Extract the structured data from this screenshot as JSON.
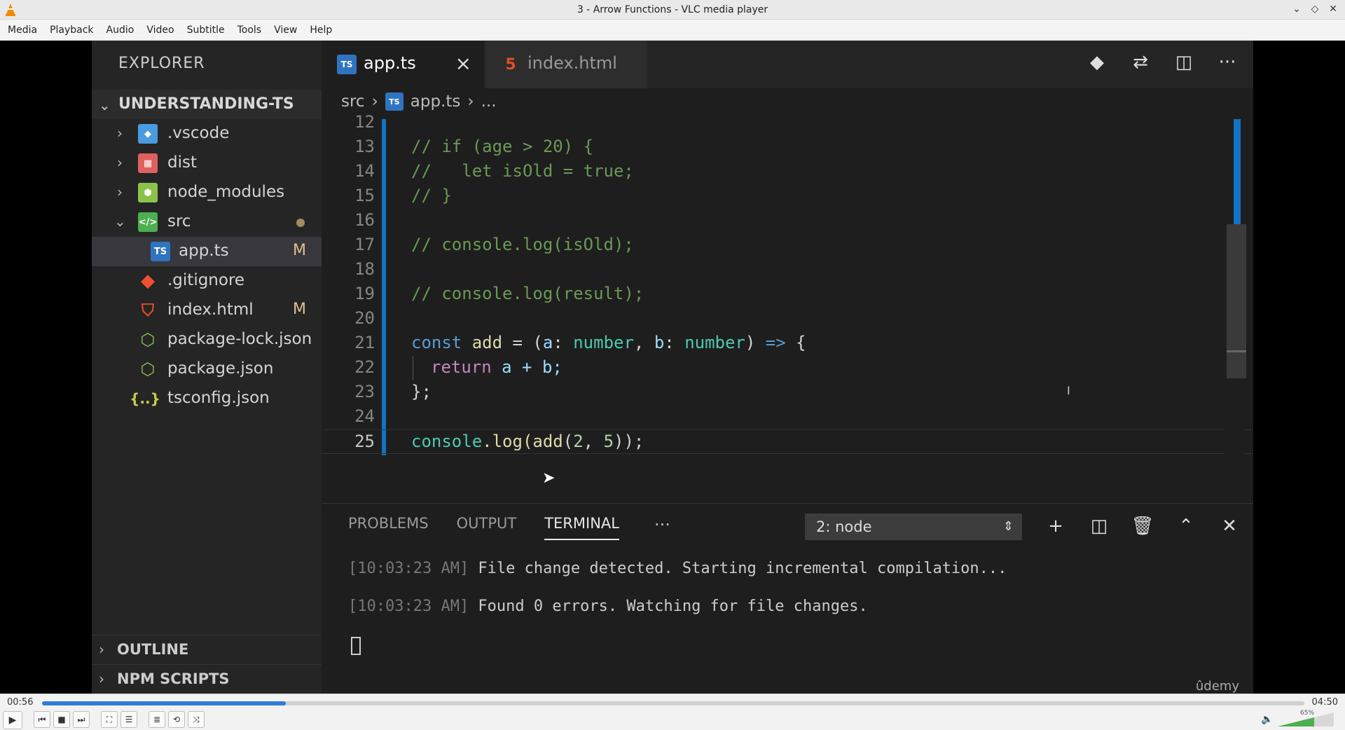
{
  "window": {
    "title": "3 - Arrow Functions - VLC media player"
  },
  "menu": [
    "Media",
    "Playback",
    "Audio",
    "Video",
    "Subtitle",
    "Tools",
    "View",
    "Help"
  ],
  "explorer": {
    "title": "EXPLORER",
    "project": "UNDERSTANDING-TS",
    "items": [
      {
        "label": ".vscode",
        "badge": "",
        "icon": "folder-vscode-icon"
      },
      {
        "label": "dist",
        "badge": "",
        "icon": "folder-dist-icon"
      },
      {
        "label": "node_modules",
        "badge": "",
        "icon": "folder-node-icon"
      },
      {
        "label": "src",
        "badge": "",
        "icon": "folder-src-icon"
      },
      {
        "label": "app.ts",
        "badge": "M",
        "icon": "typescript-file-icon"
      },
      {
        "label": ".gitignore",
        "badge": "",
        "icon": "git-icon"
      },
      {
        "label": "index.html",
        "badge": "M",
        "icon": "html5-icon"
      },
      {
        "label": "package-lock.json",
        "badge": "",
        "icon": "nodejs-icon"
      },
      {
        "label": "package.json",
        "badge": "",
        "icon": "nodejs-icon"
      },
      {
        "label": "tsconfig.json",
        "badge": "",
        "icon": "json-braces-icon"
      }
    ],
    "sections": [
      "OUTLINE",
      "NPM SCRIPTS"
    ]
  },
  "editor": {
    "tabs": [
      {
        "label": "app.ts",
        "icon_text": "TS"
      },
      {
        "label": "index.html",
        "icon_text": "5"
      }
    ],
    "breadcrumb": {
      "folder": "src",
      "file": "app.ts",
      "more": "..."
    },
    "lines": [
      "12",
      "13",
      "14",
      "15",
      "16",
      "17",
      "18",
      "19",
      "20",
      "21",
      "22",
      "23",
      "24",
      "25"
    ],
    "code": {
      "l13": "// if (age > 20) {",
      "l14": "//   let isOld = true;",
      "l15": "// }",
      "l17": "// console.log(isOld);",
      "l19": "// console.log(result);",
      "l21": {
        "const": "const",
        "name": "add",
        "eq": " = (",
        "a": "a",
        "c1": ": ",
        "t1": "number",
        "comma": ", ",
        "b": "b",
        "c2": ": ",
        "t2": "number",
        "close": ") ",
        "arrow": "=>",
        "brace": " {"
      },
      "l22": {
        "ret": "return",
        "expr": " a + b;"
      },
      "l23": "};",
      "l25": {
        "console": "console",
        "log": ".log(",
        "fn": "add",
        "args1": "(",
        "n1": "2",
        "sep": ", ",
        "n2": "5",
        "end": "));"
      }
    }
  },
  "panel": {
    "tabs": [
      "PROBLEMS",
      "OUTPUT",
      "TERMINAL"
    ],
    "more": "···",
    "terminal_select": "2: node",
    "terminal": [
      {
        "time": "[10:03:23 AM]",
        "msg": " File change detected. Starting incremental compilation..."
      },
      {
        "time": "[10:03:23 AM]",
        "msg": " Found 0 errors. Watching for file changes."
      }
    ],
    "watermark": "ûdemy"
  },
  "player": {
    "time_current": "00:56",
    "time_total": "04:50",
    "progress": 0.193,
    "volume_label": "65%",
    "volume": 0.65
  },
  "colors": {
    "accent": "#1273c4",
    "seek": "#2e7dd7"
  }
}
